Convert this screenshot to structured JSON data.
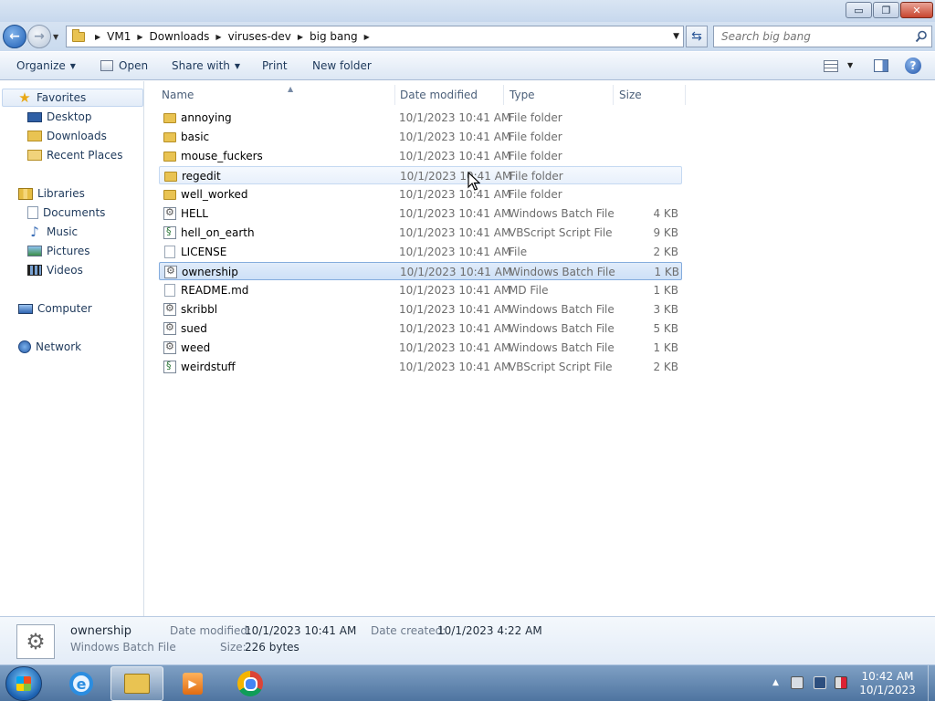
{
  "window": {
    "controls": {
      "minimize": "▭",
      "maximize": "❐",
      "close": "✕"
    }
  },
  "address": {
    "breadcrumbs": [
      "VM1",
      "Downloads",
      "viruses-dev",
      "big bang"
    ],
    "search_placeholder": "Search big bang"
  },
  "toolbar": {
    "organize": "Organize",
    "open": "Open",
    "share_with": "Share with",
    "print": "Print",
    "new_folder": "New folder",
    "help": "?"
  },
  "sidebar": {
    "favorites": "Favorites",
    "favorites_items": [
      "Desktop",
      "Downloads",
      "Recent Places"
    ],
    "libraries": "Libraries",
    "libraries_items": [
      "Documents",
      "Music",
      "Pictures",
      "Videos"
    ],
    "computer": "Computer",
    "network": "Network"
  },
  "columns": {
    "name": "Name",
    "date": "Date modified",
    "type": "Type",
    "size": "Size"
  },
  "files": [
    {
      "name": "annoying",
      "date": "10/1/2023 10:41 AM",
      "type": "File folder",
      "size": "",
      "icon": "folder-icon"
    },
    {
      "name": "basic",
      "date": "10/1/2023 10:41 AM",
      "type": "File folder",
      "size": "",
      "icon": "folder-icon"
    },
    {
      "name": "mouse_fuckers",
      "date": "10/1/2023 10:41 AM",
      "type": "File folder",
      "size": "",
      "icon": "folder-icon"
    },
    {
      "name": "regedit",
      "date": "10/1/2023 10:41 AM",
      "type": "File folder",
      "size": "",
      "icon": "folder-icon",
      "state": "hover"
    },
    {
      "name": "well_worked",
      "date": "10/1/2023 10:41 AM",
      "type": "File folder",
      "size": "",
      "icon": "folder-icon"
    },
    {
      "name": "HELL",
      "date": "10/1/2023 10:41 AM",
      "type": "Windows Batch File",
      "size": "4 KB",
      "icon": "batch-file-icon"
    },
    {
      "name": "hell_on_earth",
      "date": "10/1/2023 10:41 AM",
      "type": "VBScript Script File",
      "size": "9 KB",
      "icon": "vbscript-file-icon"
    },
    {
      "name": "LICENSE",
      "date": "10/1/2023 10:41 AM",
      "type": "File",
      "size": "2 KB",
      "icon": "blank-file-icon"
    },
    {
      "name": "ownership",
      "date": "10/1/2023 10:41 AM",
      "type": "Windows Batch File",
      "size": "1 KB",
      "icon": "batch-file-icon",
      "state": "selected"
    },
    {
      "name": "README.md",
      "date": "10/1/2023 10:41 AM",
      "type": "MD File",
      "size": "1 KB",
      "icon": "blank-file-icon"
    },
    {
      "name": "skribbl",
      "date": "10/1/2023 10:41 AM",
      "type": "Windows Batch File",
      "size": "3 KB",
      "icon": "batch-file-icon"
    },
    {
      "name": "sued",
      "date": "10/1/2023 10:41 AM",
      "type": "Windows Batch File",
      "size": "5 KB",
      "icon": "batch-file-icon"
    },
    {
      "name": "weed",
      "date": "10/1/2023 10:41 AM",
      "type": "Windows Batch File",
      "size": "1 KB",
      "icon": "batch-file-icon"
    },
    {
      "name": "weirdstuff",
      "date": "10/1/2023 10:41 AM",
      "type": "VBScript Script File",
      "size": "2 KB",
      "icon": "vbscript-file-icon"
    }
  ],
  "details": {
    "name": "ownership",
    "type": "Windows Batch File",
    "date_modified_label": "Date modified:",
    "date_modified": "10/1/2023 10:41 AM",
    "date_created_label": "Date created:",
    "date_created": "10/1/2023 4:22 AM",
    "size_label": "Size:",
    "size": "226 bytes"
  },
  "taskbar": {
    "ie_glyph": "e",
    "media_glyph": "▶",
    "clock_time": "10:42 AM",
    "clock_date": "10/1/2023"
  },
  "colors": {
    "accent": "#1e395b",
    "selection": "#cde0f7",
    "folder": "#e9c352"
  }
}
